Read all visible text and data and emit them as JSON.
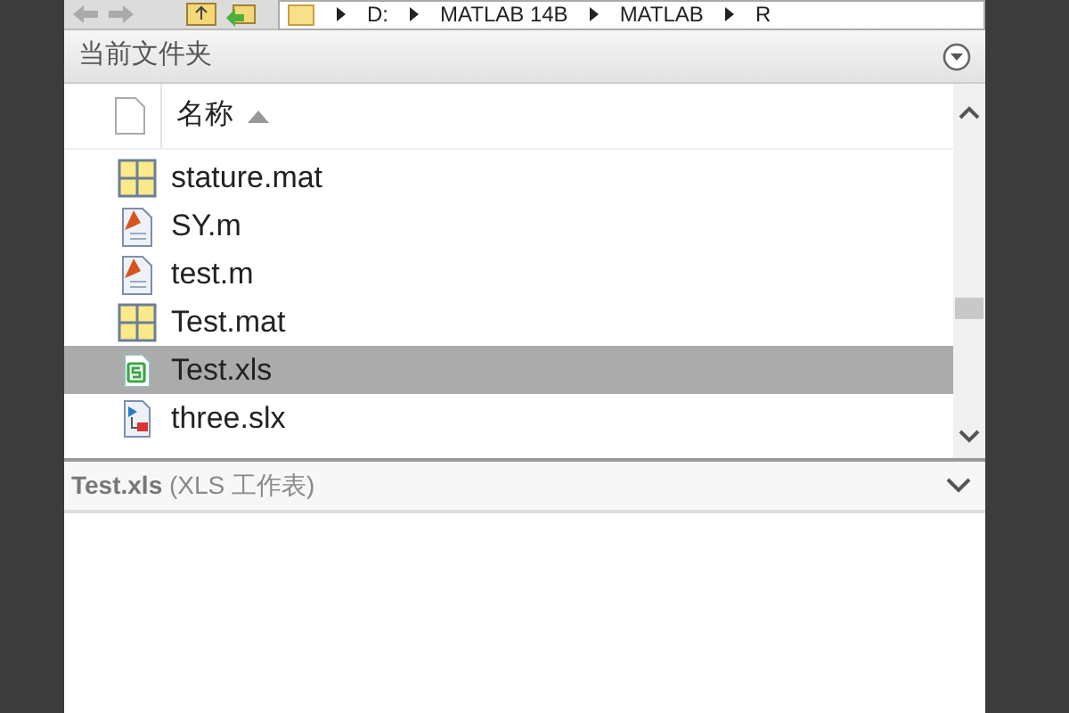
{
  "path": [
    "D:",
    "MATLAB 14B",
    "MATLAB",
    "R"
  ],
  "panel": {
    "title": "当前文件夹"
  },
  "columns": [
    {
      "label": "名称",
      "sorted_ascending": true
    }
  ],
  "files": [
    {
      "name": "stature.mat",
      "kind": "mat",
      "selected": false
    },
    {
      "name": "SY.m",
      "kind": "m",
      "selected": false
    },
    {
      "name": "test.m",
      "kind": "m",
      "selected": false
    },
    {
      "name": "Test.mat",
      "kind": "mat",
      "selected": false
    },
    {
      "name": "Test.xls",
      "kind": "xls",
      "selected": true
    },
    {
      "name": "three.slx",
      "kind": "slx",
      "selected": false
    }
  ],
  "details": {
    "name": "Test.xls",
    "type": "(XLS 工作表)"
  }
}
